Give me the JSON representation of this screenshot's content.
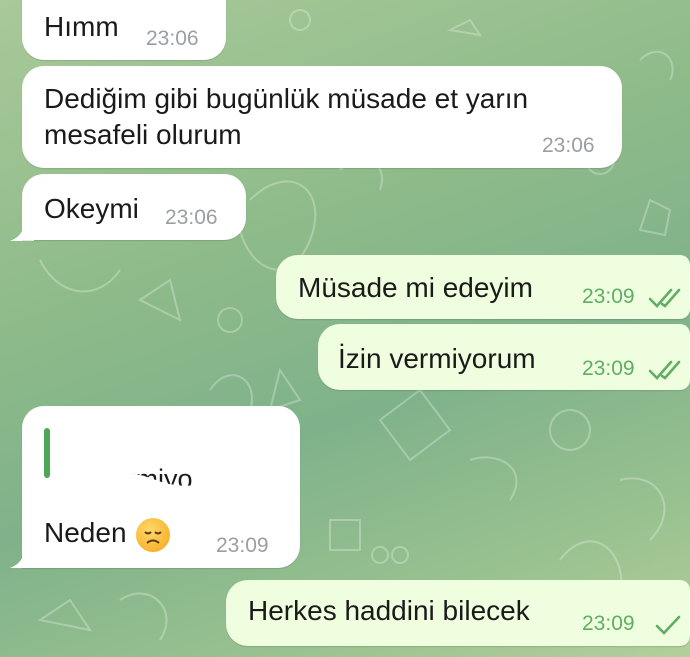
{
  "colors": {
    "bg": "#8fbb8a",
    "incoming": "#ffffff",
    "outgoing": "#eefedf",
    "accent": "#5fae63"
  },
  "messages": [
    {
      "dir": "in",
      "text": "Hımm",
      "time": "23:06"
    },
    {
      "dir": "in",
      "line1": "Dediğim gibi bugünlük müsade et yarın",
      "line2": "mesafeli olurum",
      "time": "23:06"
    },
    {
      "dir": "in",
      "text": "Okeymi",
      "time": "23:06"
    },
    {
      "dir": "out",
      "text": "Müsade mi edeyim",
      "time": "23:09",
      "status": "double-check-icon"
    },
    {
      "dir": "out",
      "text": "İzin vermiyorum",
      "time": "23:09",
      "status": "double-check-icon"
    },
    {
      "dir": "in",
      "reply_snippet": "vermiyo",
      "text": "Neden",
      "emoji": "disappointed-face",
      "time": "23:09"
    },
    {
      "dir": "out",
      "text": "Herkes haddini bilecek",
      "time": "23:09",
      "status": "single-check-icon"
    }
  ]
}
